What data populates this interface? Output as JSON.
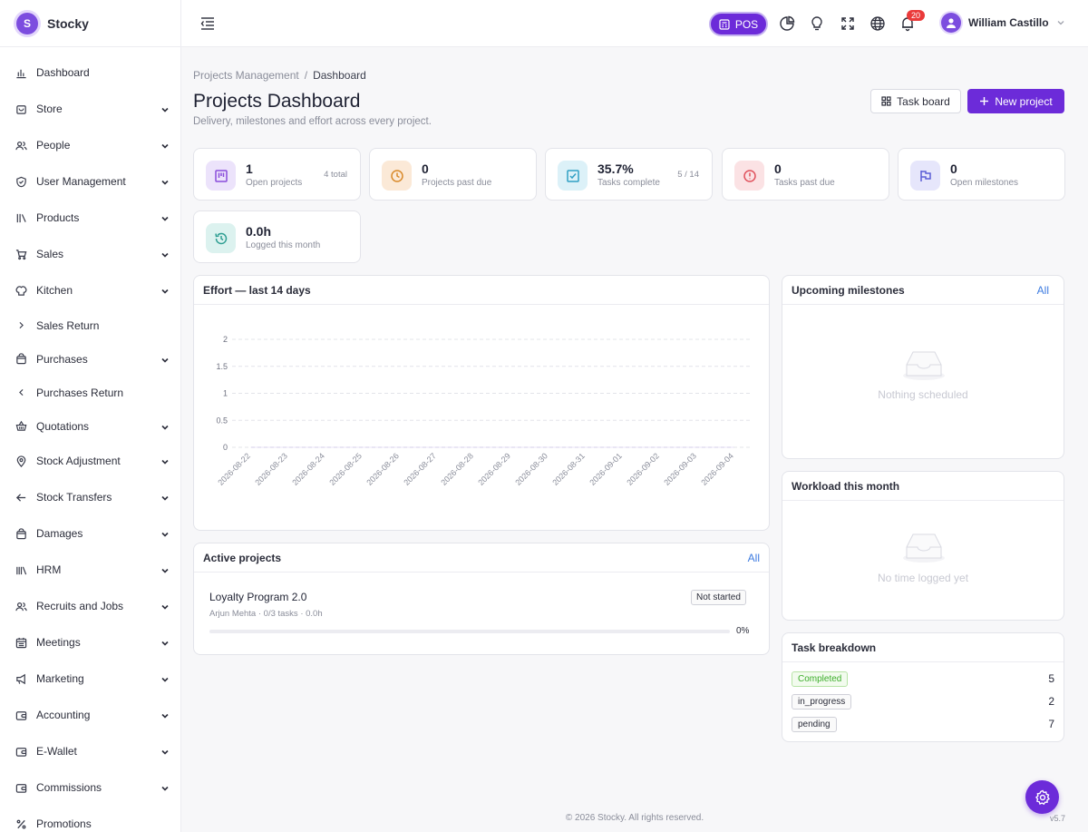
{
  "brand": {
    "name": "Stocky",
    "logo_letter": "S"
  },
  "sidebar": {
    "items": [
      {
        "label": "Dashboard",
        "icon": "bar-chart-icon",
        "chevron": "none"
      },
      {
        "label": "Store",
        "icon": "store-icon",
        "chevron": "down"
      },
      {
        "label": "People",
        "icon": "people-icon",
        "chevron": "down"
      },
      {
        "label": "User Management",
        "icon": "shield-icon",
        "chevron": "down"
      },
      {
        "label": "Products",
        "icon": "books-icon",
        "chevron": "down"
      },
      {
        "label": "Sales",
        "icon": "cart-icon",
        "chevron": "down"
      },
      {
        "label": "Kitchen",
        "icon": "chef-hat-icon",
        "chevron": "down"
      },
      {
        "label": "Sales Return",
        "icon": "chevron-right-icon",
        "chevron": "none"
      },
      {
        "label": "Purchases",
        "icon": "bag-icon",
        "chevron": "down"
      },
      {
        "label": "Purchases Return",
        "icon": "chevron-left-icon",
        "chevron": "none"
      },
      {
        "label": "Quotations",
        "icon": "basket-icon",
        "chevron": "down"
      },
      {
        "label": "Stock Adjustment",
        "icon": "location-pin-icon",
        "chevron": "down"
      },
      {
        "label": "Stock Transfers",
        "icon": "arrow-left-icon",
        "chevron": "down"
      },
      {
        "label": "Damages",
        "icon": "bag-icon",
        "chevron": "down"
      },
      {
        "label": "HRM",
        "icon": "library-icon",
        "chevron": "down"
      },
      {
        "label": "Recruits and Jobs",
        "icon": "people-icon",
        "chevron": "down"
      },
      {
        "label": "Meetings",
        "icon": "calendar-icon",
        "chevron": "down"
      },
      {
        "label": "Marketing",
        "icon": "megaphone-icon",
        "chevron": "down"
      },
      {
        "label": "Accounting",
        "icon": "wallet-icon",
        "chevron": "down"
      },
      {
        "label": "E-Wallet",
        "icon": "wallet-icon",
        "chevron": "down"
      },
      {
        "label": "Commissions",
        "icon": "wallet-icon",
        "chevron": "down"
      },
      {
        "label": "Promotions",
        "icon": "percent-icon",
        "chevron": "none"
      }
    ]
  },
  "topbar": {
    "pos_label": "POS",
    "notification_count": "20",
    "user_name": "William Castillo"
  },
  "breadcrumb": {
    "parent": "Projects Management",
    "separator": "/",
    "current": "Dashboard"
  },
  "header": {
    "title": "Projects Dashboard",
    "subtitle": "Delivery, milestones and effort across every project.",
    "task_board_label": "Task board",
    "new_project_label": "New project"
  },
  "stats": [
    {
      "value": "1",
      "label": "Open projects",
      "aux": "4 total",
      "icon": "kanban-icon",
      "color": "#8a4ddb",
      "bg": "#ece3fb"
    },
    {
      "value": "0",
      "label": "Projects past due",
      "aux": "",
      "icon": "clock-icon",
      "color": "#d98a2b",
      "bg": "#fbe9d7"
    },
    {
      "value": "35.7%",
      "label": "Tasks complete",
      "aux": "5 / 14",
      "icon": "checkbox-icon",
      "color": "#2f9fc4",
      "bg": "#dcf1f8"
    },
    {
      "value": "0",
      "label": "Tasks past due",
      "aux": "",
      "icon": "alert-icon",
      "color": "#e0525d",
      "bg": "#fbe2e4"
    },
    {
      "value": "0",
      "label": "Open milestones",
      "aux": "",
      "icon": "flag-icon",
      "color": "#5b5fd6",
      "bg": "#e6e6fb"
    },
    {
      "value": "0.0h",
      "label": "Logged this month",
      "aux": "",
      "icon": "history-icon",
      "color": "#2e9e92",
      "bg": "#dcf2ef"
    }
  ],
  "effort": {
    "title": "Effort — last 14 days"
  },
  "chart_data": {
    "type": "line",
    "title": "Effort — last 14 days",
    "x": [
      "2026-08-22",
      "2026-08-23",
      "2026-08-24",
      "2026-08-25",
      "2026-08-26",
      "2026-08-27",
      "2026-08-28",
      "2026-08-29",
      "2026-08-30",
      "2026-08-31",
      "2026-09-01",
      "2026-09-02",
      "2026-09-03",
      "2026-09-04"
    ],
    "series": [
      {
        "values": [
          0,
          0,
          0,
          0,
          0,
          0,
          0,
          0,
          0,
          0,
          0,
          0,
          0,
          0
        ]
      }
    ],
    "y_ticks": [
      "2",
      "1.5",
      "1",
      "0.5",
      "0"
    ],
    "ylim": [
      0,
      2
    ],
    "grid": true
  },
  "active_projects": {
    "title": "Active projects",
    "all_label": "All",
    "items": [
      {
        "name": "Loyalty Program 2.0",
        "meta": "Arjun Mehta · 0/3 tasks · 0.0h",
        "status": "Not started",
        "progress_pct": "0%",
        "progress": 0
      }
    ]
  },
  "milestones": {
    "title": "Upcoming milestones",
    "all_label": "All",
    "empty_text": "Nothing scheduled"
  },
  "workload": {
    "title": "Workload this month",
    "empty_text": "No time logged yet"
  },
  "task_breakdown": {
    "title": "Task breakdown",
    "rows": [
      {
        "status": "Completed",
        "count": "5"
      },
      {
        "status": "in_progress",
        "count": "2"
      },
      {
        "status": "pending",
        "count": "7"
      }
    ]
  },
  "footer": {
    "text": "© 2026 Stocky. All rights reserved.",
    "version": "v5.7"
  }
}
